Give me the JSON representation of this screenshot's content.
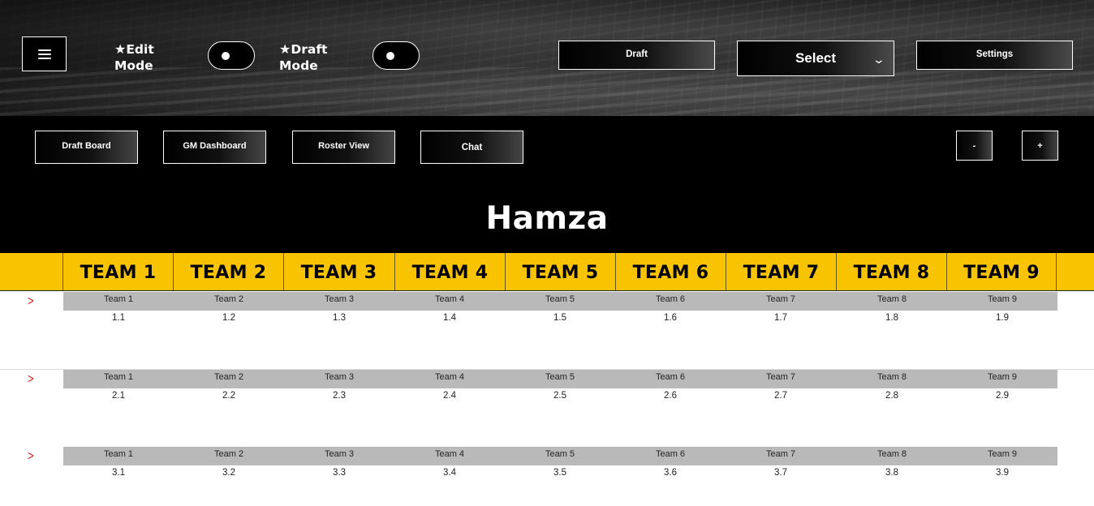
{
  "header": {
    "edit_mode_label": "Edit Mode",
    "edit_mode_line1": "Edit",
    "edit_mode_line2": "Mode",
    "draft_mode_line1": "Draft",
    "draft_mode_line2": "Mode",
    "draft_button": "Draft",
    "select_button": "Select",
    "settings_button": "Settings"
  },
  "nav": {
    "draft_board": "Draft Board",
    "gm_dashboard": "GM Dashboard",
    "roster_view": "Roster View",
    "chat": "Chat",
    "zoom_out": "-",
    "zoom_in": "+"
  },
  "board": {
    "title": "Hamza",
    "teams": [
      "TEAM 1",
      "TEAM 2",
      "TEAM 3",
      "TEAM 4",
      "TEAM 5",
      "TEAM 6",
      "TEAM 7",
      "TEAM 8",
      "TEAM 9"
    ],
    "rounds": [
      {
        "picks": [
          {
            "team": "Team 1",
            "pick": "1.1"
          },
          {
            "team": "Team 2",
            "pick": "1.2"
          },
          {
            "team": "Team 3",
            "pick": "1.3"
          },
          {
            "team": "Team 4",
            "pick": "1.4"
          },
          {
            "team": "Team 5",
            "pick": "1.5"
          },
          {
            "team": "Team 6",
            "pick": "1.6"
          },
          {
            "team": "Team 7",
            "pick": "1.7"
          },
          {
            "team": "Team 8",
            "pick": "1.8"
          },
          {
            "team": "Team 9",
            "pick": "1.9"
          }
        ]
      },
      {
        "picks": [
          {
            "team": "Team 1",
            "pick": "2.1"
          },
          {
            "team": "Team 2",
            "pick": "2.2"
          },
          {
            "team": "Team 3",
            "pick": "2.3"
          },
          {
            "team": "Team 4",
            "pick": "2.4"
          },
          {
            "team": "Team 5",
            "pick": "2.5"
          },
          {
            "team": "Team 6",
            "pick": "2.6"
          },
          {
            "team": "Team 7",
            "pick": "2.7"
          },
          {
            "team": "Team 8",
            "pick": "2.8"
          },
          {
            "team": "Team 9",
            "pick": "2.9"
          }
        ]
      },
      {
        "picks": [
          {
            "team": "Team 1",
            "pick": "3.1"
          },
          {
            "team": "Team 2",
            "pick": "3.2"
          },
          {
            "team": "Team 3",
            "pick": "3.3"
          },
          {
            "team": "Team 4",
            "pick": "3.4"
          },
          {
            "team": "Team 5",
            "pick": "3.5"
          },
          {
            "team": "Team 6",
            "pick": "3.6"
          },
          {
            "team": "Team 7",
            "pick": "3.7"
          },
          {
            "team": "Team 8",
            "pick": "3.8"
          },
          {
            "team": "Team 9",
            "pick": "3.9"
          }
        ]
      }
    ]
  },
  "colors": {
    "accent": "#f8c300",
    "pick_strip": "#b9b9b9",
    "arrow": "#d02020"
  }
}
